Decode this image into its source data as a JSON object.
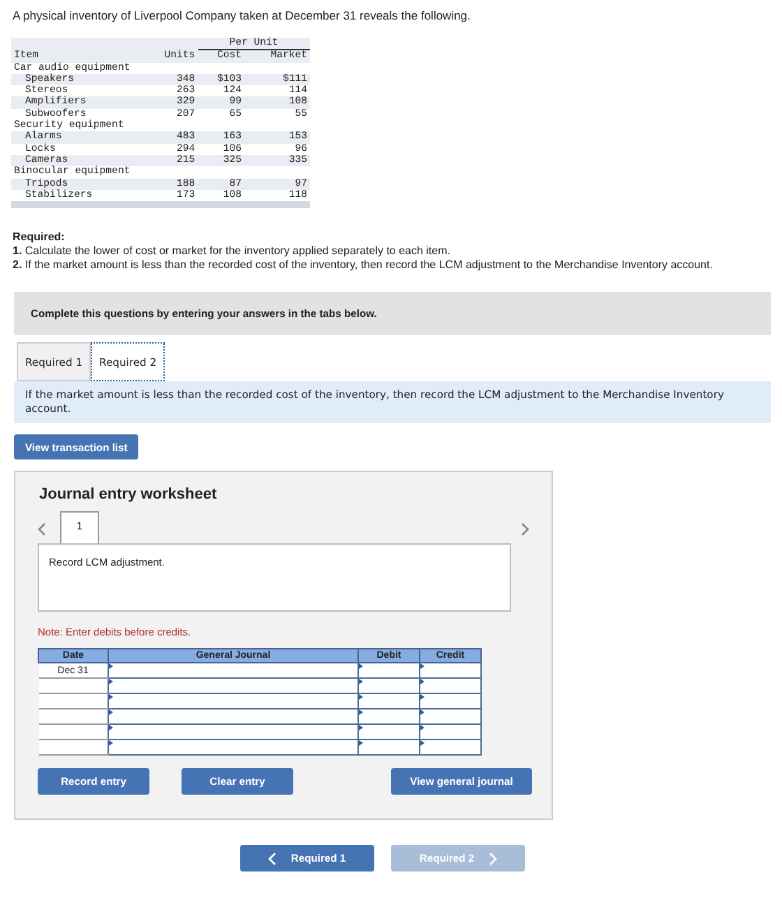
{
  "intro": "A physical inventory of Liverpool Company taken at December 31 reveals the following.",
  "inventory_table": {
    "group_header": "Per Unit",
    "columns": [
      "Item",
      "Units",
      "Cost",
      "Market"
    ],
    "groups": [
      {
        "name": "Car audio equipment",
        "items": [
          {
            "item": "Speakers",
            "units": "348",
            "cost": "$103",
            "market": "$111"
          },
          {
            "item": "Stereos",
            "units": "263",
            "cost": "124",
            "market": "114"
          },
          {
            "item": "Amplifiers",
            "units": "329",
            "cost": "99",
            "market": "108"
          },
          {
            "item": "Subwoofers",
            "units": "207",
            "cost": "65",
            "market": "55"
          }
        ]
      },
      {
        "name": "Security equipment",
        "items": [
          {
            "item": "Alarms",
            "units": "483",
            "cost": "163",
            "market": "153"
          },
          {
            "item": "Locks",
            "units": "294",
            "cost": "106",
            "market": "96"
          },
          {
            "item": "Cameras",
            "units": "215",
            "cost": "325",
            "market": "335"
          }
        ]
      },
      {
        "name": "Binocular equipment",
        "items": [
          {
            "item": "Tripods",
            "units": "188",
            "cost": "87",
            "market": "97"
          },
          {
            "item": "Stabilizers",
            "units": "173",
            "cost": "108",
            "market": "118"
          }
        ]
      }
    ]
  },
  "required": {
    "heading": "Required:",
    "items": [
      "**1.** Calculate the lower of cost or market for the inventory applied separately to each item.",
      "**2.** If the market amount is less than the recorded cost of the inventory, then record the LCM adjustment to the Merchandise Inventory account."
    ]
  },
  "banner": "Complete this questions by entering your answers in the tabs below.",
  "tabs": [
    {
      "label": "Required 1",
      "selected": false
    },
    {
      "label": "Required 2",
      "selected": true
    }
  ],
  "tab_instruction": "If the market amount is less than the recorded cost of the inventory, then record the LCM adjustment to the Merchandise Inventory account.",
  "view_transaction_button": "View transaction list",
  "worksheet": {
    "title": "Journal entry worksheet",
    "entry_tabs": [
      {
        "label": "1",
        "selected": true
      }
    ],
    "description": "Record LCM adjustment.",
    "note": "Note: Enter debits before credits.",
    "columns": [
      "Date",
      "General Journal",
      "Debit",
      "Credit"
    ],
    "rows": [
      {
        "date": "Dec 31"
      },
      {},
      {},
      {},
      {},
      {}
    ],
    "buttons": [
      "Record entry",
      "Clear entry",
      "View general journal"
    ]
  },
  "nav_buttons": [
    {
      "label": "Required 1",
      "kind": "prev",
      "disabled": false
    },
    {
      "label": "Required 2",
      "kind": "next",
      "disabled": true
    }
  ]
}
